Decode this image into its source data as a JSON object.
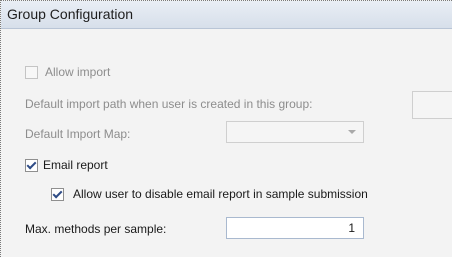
{
  "group": {
    "title": "Group Configuration"
  },
  "allow_import": {
    "label": "Allow import",
    "checked": false,
    "enabled": false
  },
  "default_import_path": {
    "label": "Default import path when user is created in this group:",
    "value": ""
  },
  "default_import_map": {
    "label": "Default Import Map:",
    "selected": ""
  },
  "email_report": {
    "label": "Email report",
    "checked": true
  },
  "allow_disable_email": {
    "label": "Allow user to disable email report in sample submission",
    "checked": true
  },
  "max_methods": {
    "label": "Max. methods per sample:",
    "value": "1"
  },
  "colors": {
    "header_bg": "#dfe6ef",
    "disabled_text": "#8d8d8d",
    "check_mark": "#2f4c86"
  }
}
